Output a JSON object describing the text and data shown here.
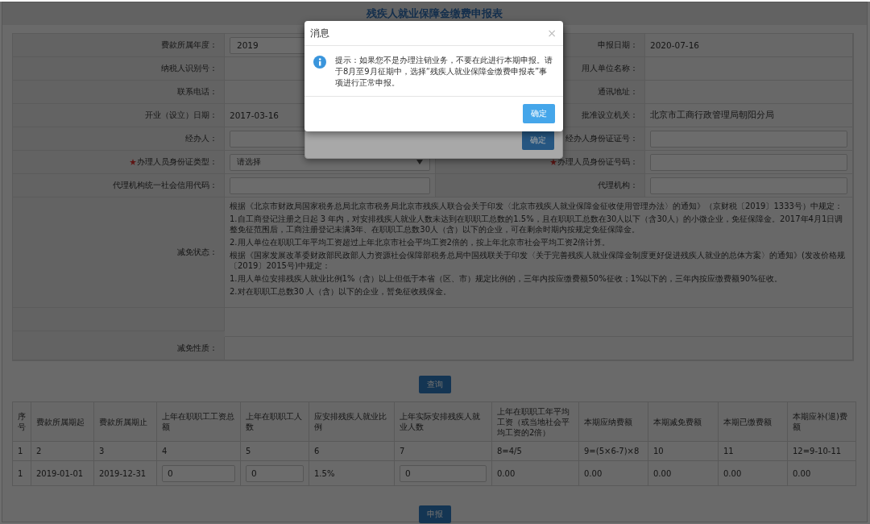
{
  "page_title": "残疾人就业保障金缴费申报表",
  "form_rows": [
    {
      "left": {
        "label": "费款所属年度：",
        "required": false,
        "kind": "input",
        "value": "2019"
      },
      "right": {
        "label": "申报日期：",
        "required": false,
        "kind": "text",
        "value": "2020-07-16"
      }
    },
    {
      "left": {
        "label": "纳税人识别号：",
        "required": false,
        "kind": "text"
      },
      "right": {
        "label": "用人单位名称：",
        "required": false,
        "kind": "text"
      }
    },
    {
      "left": {
        "label": "联系电话：",
        "required": false,
        "kind": "text"
      },
      "right": {
        "label": "通讯地址：",
        "required": false,
        "kind": "text"
      }
    },
    {
      "left": {
        "label": "开业（设立）日期：",
        "required": false,
        "kind": "text",
        "value": "2017-03-16"
      },
      "right": {
        "label": "批准设立机关：",
        "required": false,
        "kind": "text",
        "value": "北京市工商行政管理局朝阳分局"
      }
    },
    {
      "left": {
        "label": "经办人：",
        "required": false,
        "kind": "input"
      },
      "right": {
        "label": "经办人身份证证号：",
        "required": false,
        "kind": "input"
      }
    },
    {
      "left": {
        "label": "办理人员身份证类型：",
        "required": true,
        "kind": "select",
        "value": "请选择"
      },
      "right": {
        "label": "办理人员身份证号码：",
        "required": true,
        "kind": "input"
      }
    },
    {
      "left": {
        "label": "代理机构统一社会信用代码：",
        "required": false,
        "kind": "input"
      },
      "right": {
        "label": "代理机构：",
        "required": false,
        "kind": "input"
      }
    }
  ],
  "exemption_status": {
    "label": "减免状态：",
    "paragraphs": [
      "根据《北京市财政局国家税务总局北京市税务局北京市残疾人联合会关于印发〈北京市残疾人就业保障金征收使用管理办法〉的通知》（京财税〔2019〕1333号）中规定：",
      "1.自工商登记注册之日起 3 年内，对安排残疾人就业人数未达到在职职工总数的1.5%，且在职职工总数在30人以下（含30人）的小微企业，免征保障金。2017年4月1日调整免征范围后，工商注册登记未满3年、在职职工总数30人（含）以下的企业，可在剩余时期内按规定免征保障金。",
      "2.用人单位在职职工年平均工资超过上年北京市社会平均工资2倍的，按上年北京市社会平均工资2倍计算。",
      "根据《国家发展改革委财政部民政部人力资源社会保障部税务总局中国残联关于印发〈关于完善残疾人就业保障金制度更好促进残疾人就业的总体方案〉的通知》(发改价格规〔2019〕2015号)中规定：",
      "1.用人单位安排残疾人就业比例1%（含）以上但低于本省（区、市）规定比例的，三年内按应缴费额50%征收；1%以下的，三年内按应缴费额90%征收。",
      "2.对在职职工总数30 人（含）以下的企业，暂免征收残保金。"
    ]
  },
  "exemption_type": {
    "label": "减免性质："
  },
  "query_button": "查询",
  "table": {
    "columns": [
      "序号",
      "费款所属期起",
      "费款所属期止",
      "上年在职职工工资总额",
      "上年在职职工人数",
      "应安排残疾人就业比例",
      "上年实际安排残疾人就业人数",
      "上年在职职工年平均工资（或当地社会平均工资的2倍）",
      "本期应纳费额",
      "本期减免费额",
      "本期已缴费额",
      "本期应补(退)费额"
    ],
    "rows": [
      [
        {
          "kind": "text",
          "value": "1"
        },
        {
          "kind": "text",
          "value": "2"
        },
        {
          "kind": "text",
          "value": "3"
        },
        {
          "kind": "text",
          "value": "4"
        },
        {
          "kind": "text",
          "value": "5"
        },
        {
          "kind": "text",
          "value": "6"
        },
        {
          "kind": "text",
          "value": "7"
        },
        {
          "kind": "text",
          "value": "8=4/5"
        },
        {
          "kind": "text",
          "value": "9=(5×6-7)×8"
        },
        {
          "kind": "text",
          "value": "10"
        },
        {
          "kind": "text",
          "value": "11"
        },
        {
          "kind": "text",
          "value": "12=9-10-11"
        }
      ],
      [
        {
          "kind": "text",
          "value": "1"
        },
        {
          "kind": "text",
          "value": "2019-01-01"
        },
        {
          "kind": "text",
          "value": "2019-12-31"
        },
        {
          "kind": "input",
          "value": "0"
        },
        {
          "kind": "input",
          "value": "0"
        },
        {
          "kind": "text",
          "value": "1.5%"
        },
        {
          "kind": "input",
          "value": "0"
        },
        {
          "kind": "text",
          "value": "0.00"
        },
        {
          "kind": "text",
          "value": "0.00"
        },
        {
          "kind": "text",
          "value": "0.00"
        },
        {
          "kind": "text",
          "value": "0.00"
        },
        {
          "kind": "text",
          "value": "0.00"
        }
      ]
    ]
  },
  "submit_button": "申报",
  "back_dialog": {
    "button": "确定"
  },
  "dialog": {
    "title": "消息",
    "close": "×",
    "message": "提示：如果您不是办理注销业务，不要在此进行本期申报。请于8月至9月征期中，选择“残疾人就业保障金缴费申报表”事项进行正常申报。",
    "button": "确定"
  }
}
